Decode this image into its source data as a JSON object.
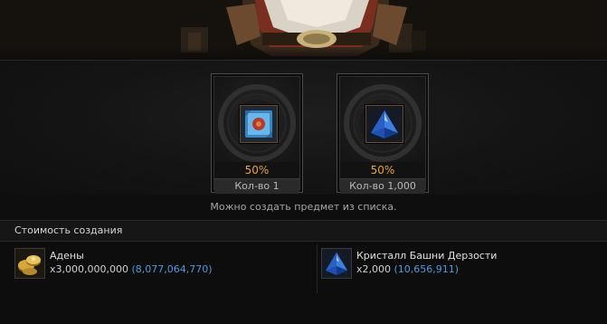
{
  "slots": [
    {
      "icon": "blue-scroll-icon",
      "chance": "50%",
      "quantity_label": "Кол-во 1"
    },
    {
      "icon": "blue-crystal-icon",
      "chance": "50%",
      "quantity_label": "Кол-во 1,000"
    }
  ],
  "info_text": "Можно создать предмет из списка.",
  "cost": {
    "title": "Стоимость создания",
    "items": [
      {
        "icon": "adena-coins-icon",
        "name": "Адены",
        "amount": "x3,000,000,000",
        "have": "(8,077,064,770)"
      },
      {
        "icon": "blue-crystal-icon",
        "name": "Кристалл Башни Дерзости",
        "amount": "x2,000",
        "have": "(10,656,911)"
      }
    ]
  },
  "colors": {
    "chance": "#e8a33c",
    "have": "#4b9be0"
  }
}
